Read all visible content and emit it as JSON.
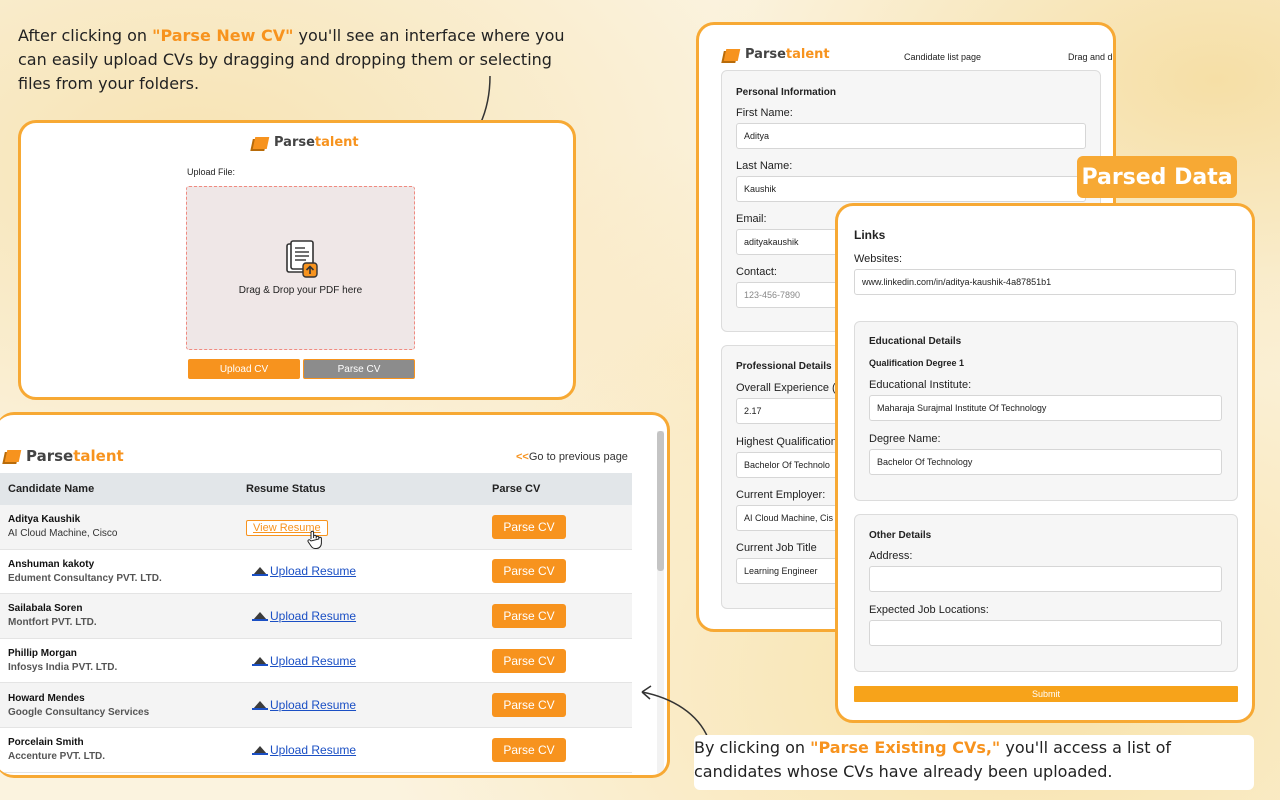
{
  "caption_top": {
    "before": "After clicking on ",
    "highlight": "\"Parse New CV\"",
    "after": " you'll see an interface where you can easily upload CVs by dragging and dropping them or selecting files from your folders."
  },
  "logo": {
    "part1": "Parse",
    "part2": "talent"
  },
  "upload_page": {
    "upload_label": "Upload File:",
    "drop_text": "Drag & Drop your PDF here",
    "upload_button": "Upload CV",
    "parse_button": "Parse CV"
  },
  "candidate_list": {
    "prev_arrow": "<<",
    "prev_link": "Go to previous page",
    "headers": {
      "name": "Candidate Name",
      "status": "Resume Status",
      "parse": "Parse CV"
    },
    "rows": [
      {
        "name": "Aditya Kaushik",
        "company": "AI Cloud Machine, Cisco",
        "status": "View Resume",
        "parse": "Parse CV"
      },
      {
        "name": "Anshuman kakoty",
        "company": "Edument Consultancy PVT. LTD.",
        "status": "Upload Resume",
        "parse": "Parse CV"
      },
      {
        "name": "Sailabala Soren",
        "company": "Montfort PVT. LTD.",
        "status": "Upload Resume",
        "parse": "Parse CV"
      },
      {
        "name": "Phillip Morgan",
        "company": "Infosys India PVT. LTD.",
        "status": "Upload Resume",
        "parse": "Parse CV"
      },
      {
        "name": "Howard Mendes",
        "company": "Google Consultancy Services",
        "status": "Upload Resume",
        "parse": "Parse CV"
      },
      {
        "name": "Porcelain Smith",
        "company": "Accenture PVT. LTD.",
        "status": "Upload Resume",
        "parse": "Parse CV"
      }
    ]
  },
  "parsed_form": {
    "nav_candidate_list": "Candidate list page",
    "nav_drag_drop": "Drag and dro",
    "personal": {
      "title": "Personal Information",
      "first_name_label": "First Name:",
      "first_name": "Aditya",
      "last_name_label": "Last Name:",
      "last_name": "Kaushik",
      "email_label": "Email:",
      "email": "adityakaushik",
      "contact_label": "Contact:",
      "contact_placeholder": "123-456-7890"
    },
    "professional": {
      "title": "Professional Details",
      "experience_label": "Overall Experience (",
      "experience": "2.17",
      "qualification_label": "Highest Qualification",
      "qualification": "Bachelor Of Technolo",
      "employer_label": "Current Employer:",
      "employer": "AI Cloud Machine, Cis",
      "job_title_label": "Current Job Title",
      "job_title": "Learning Engineer"
    }
  },
  "parsed_tag": "Parsed Data",
  "links_form": {
    "links_title": "Links",
    "websites_label": "Websites:",
    "website": "www.linkedin.com/in/aditya-kaushik-4a87851b1",
    "education": {
      "title": "Educational Details",
      "subtitle": "Qualification Degree 1",
      "institute_label": "Educational Institute:",
      "institute": "Maharaja Surajmal Institute Of Technology",
      "degree_label": "Degree Name:",
      "degree": "Bachelor Of Technology"
    },
    "other": {
      "title": "Other Details",
      "address_label": "Address:",
      "address": "",
      "locations_label": "Expected Job Locations:",
      "locations": ""
    },
    "submit": "Submit"
  },
  "caption_bottom": {
    "before": "By clicking on ",
    "highlight": "\"Parse Existing CVs,\"",
    "after": " you'll access a list of candidates whose CVs have already been uploaded."
  },
  "colors": {
    "accent": "#f7931e",
    "border": "#f7a934",
    "link": "#1a4fc4"
  }
}
